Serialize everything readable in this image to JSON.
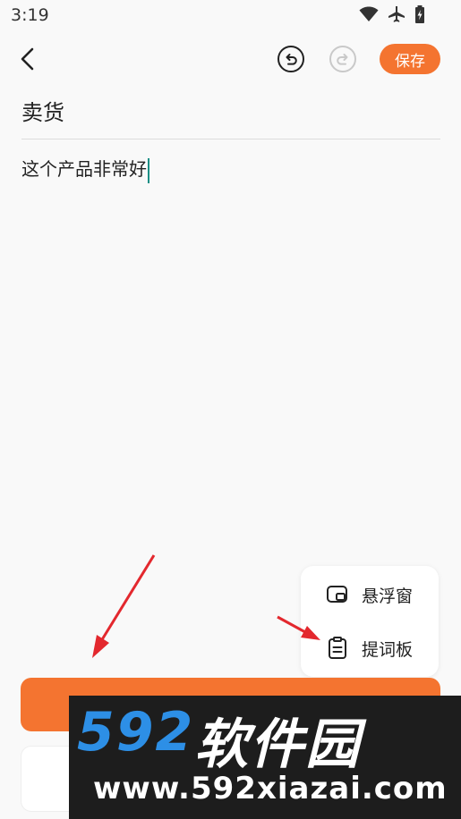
{
  "status_bar": {
    "time": "3:19"
  },
  "toolbar": {
    "save_label": "保存"
  },
  "editor": {
    "title": "卖货",
    "content": "这个产品非常好"
  },
  "popup_menu": {
    "items": [
      {
        "label": "悬浮窗",
        "icon": "floating-window-icon"
      },
      {
        "label": "提词板",
        "icon": "clipboard-icon"
      }
    ]
  },
  "watermark": {
    "brand_num": "592",
    "brand_cn": "软件园",
    "url": "www.592xiazai.com"
  },
  "colors": {
    "accent": "#f47430",
    "caret": "#1a8f85",
    "watermark_blue": "#2d8fe6"
  }
}
